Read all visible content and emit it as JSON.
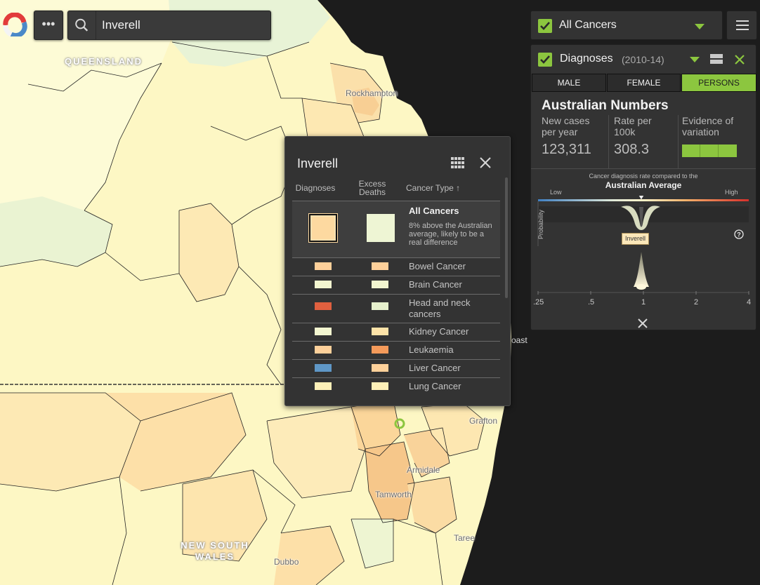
{
  "map": {
    "labels": {
      "queensland": "QUEENSLAND",
      "rockhampton": "Rockhampton",
      "coast": "oast",
      "grafton": "Grafton",
      "armidale": "Armidale",
      "tamworth": "Tamworth",
      "taree": "Taree",
      "dubbo": "Dubbo",
      "new_south_wales": "NEW SOUTH WALES"
    }
  },
  "toolbar": {
    "more_label": "•••",
    "search_value": "Inverell"
  },
  "popup": {
    "title": "Inverell",
    "col_diagnoses": "Diagnoses",
    "col_excess_deaths": "Excess Deaths",
    "col_cancer_type": "Cancer Type ↑",
    "all_cancers": {
      "title": "All Cancers",
      "description": "8% above the Australian average, likely to be a real difference",
      "diag_color": "#fdd9a0",
      "excess_color": "#eef5d4"
    },
    "rows": [
      {
        "label": "Bowel Cancer",
        "diag_color": "#fdd09a",
        "excess_color": "#fdd09a"
      },
      {
        "label": "Brain Cancer",
        "diag_color": "#f3f6d0",
        "excess_color": "#f3f6d0"
      },
      {
        "label": "Head and neck cancers",
        "diag_color": "#e0603f",
        "excess_color": "#e6f0cc"
      },
      {
        "label": "Kidney Cancer",
        "diag_color": "#f3f6d0",
        "excess_color": "#fde3a8"
      },
      {
        "label": "Leukaemia",
        "diag_color": "#fdd09a",
        "excess_color": "#f49a5a"
      },
      {
        "label": "Liver Cancer",
        "diag_color": "#5f97c6",
        "excess_color": "#fdd09a"
      },
      {
        "label": "Lung Cancer",
        "diag_color": "#fdf0b8",
        "excess_color": "#fdf0b8"
      }
    ]
  },
  "selector": {
    "label": "All Cancers"
  },
  "diagnoses_panel": {
    "title": "Diagnoses",
    "years": "(2010-14)",
    "tabs": [
      "MALE",
      "FEMALE",
      "PERSONS"
    ],
    "active_tab": "PERSONS",
    "heading": "Australian Numbers",
    "stats": {
      "new_cases_label": "New cases per year",
      "new_cases_value": "123,311",
      "rate_label": "Rate per 100k",
      "rate_value": "308.3",
      "evidence_label": "Evidence of variation"
    },
    "compare_small": "Cancer diagnosis rate compared to the",
    "compare_big": "Australian Average",
    "low_label": "Low",
    "high_label": "High",
    "probability_label": "Probability",
    "area_tag": "Inverell",
    "axis_ticks": [
      ".25",
      ".5",
      "1",
      "2",
      "4"
    ]
  },
  "colors": {
    "accent_green": "#8cc63f",
    "panel_bg": "#333333",
    "sea": "#1c1c1c"
  }
}
